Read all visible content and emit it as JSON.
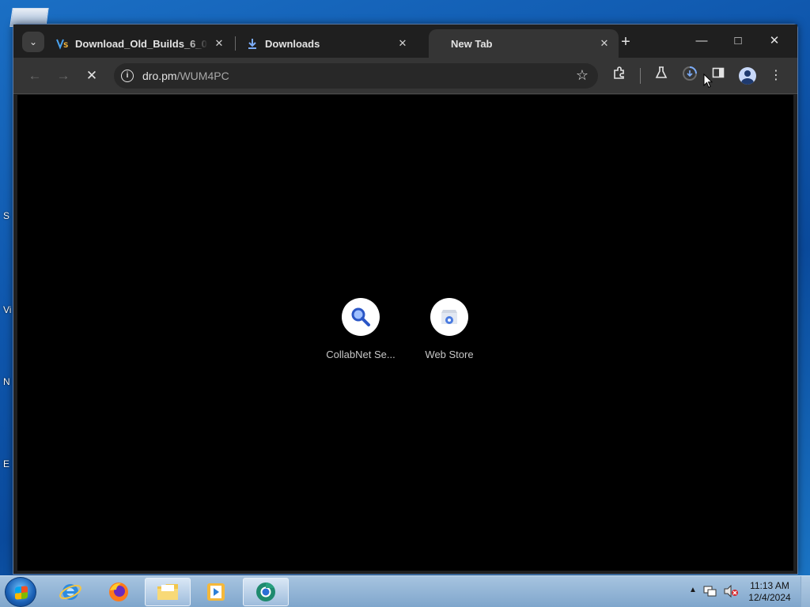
{
  "browser": {
    "tabs": [
      {
        "title": "Download_Old_Builds_6_0 – Op",
        "favicon": "vs-logo-icon"
      },
      {
        "title": "Downloads",
        "favicon": "download-icon"
      },
      {
        "title": "New Tab",
        "favicon": "none",
        "active": true
      }
    ],
    "omnibox": {
      "domain": "dro.pm",
      "path": "/WUM4PC"
    },
    "shortcuts": [
      {
        "label": "CollabNet Se...",
        "icon": "search-magnifier-icon"
      },
      {
        "label": "Web Store",
        "icon": "web-store-icon"
      }
    ]
  },
  "taskbar": {
    "clock_time": "11:13 AM",
    "clock_date": "12/4/2024",
    "apps": [
      "internet-explorer-icon",
      "firefox-icon",
      "file-explorer-icon",
      "media-player-icon",
      "chrome-dev-icon"
    ]
  },
  "desktop": {
    "side_letters": [
      "S",
      "Vi",
      "N",
      "E"
    ]
  },
  "colors": {
    "accent_blue": "#1a73e8",
    "tab_active": "#353535",
    "tabstrip": "#1f1f1f"
  }
}
